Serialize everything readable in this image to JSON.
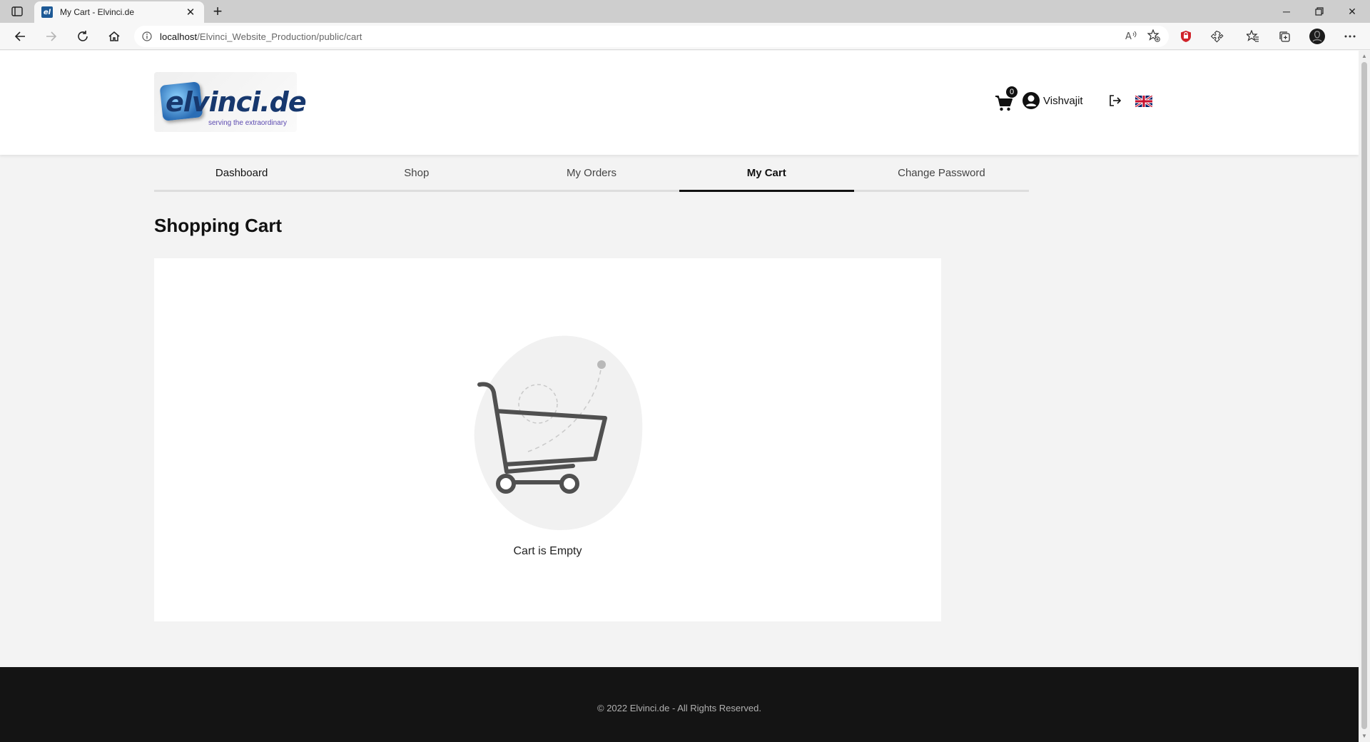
{
  "browser": {
    "tab_title": "My Cart - Elvinci.de",
    "tab_favicon_text": "el",
    "url_host": "localhost",
    "url_path": "/Elvinci_Website_Production/public/cart"
  },
  "header": {
    "logo_text": "elvinci.de",
    "logo_tagline": "serving the extraordinary",
    "cart_count": "0",
    "user_name": "Vishvajit"
  },
  "nav": {
    "tabs": [
      {
        "label": "Dashboard"
      },
      {
        "label": "Shop"
      },
      {
        "label": "My Orders"
      },
      {
        "label": "My Cart"
      },
      {
        "label": "Change Password"
      }
    ],
    "active": "My Cart"
  },
  "main": {
    "heading": "Shopping Cart",
    "empty_message": "Cart is Empty"
  },
  "footer": {
    "copyright": "© 2022 Elvinci.de - All Rights Reserved."
  }
}
